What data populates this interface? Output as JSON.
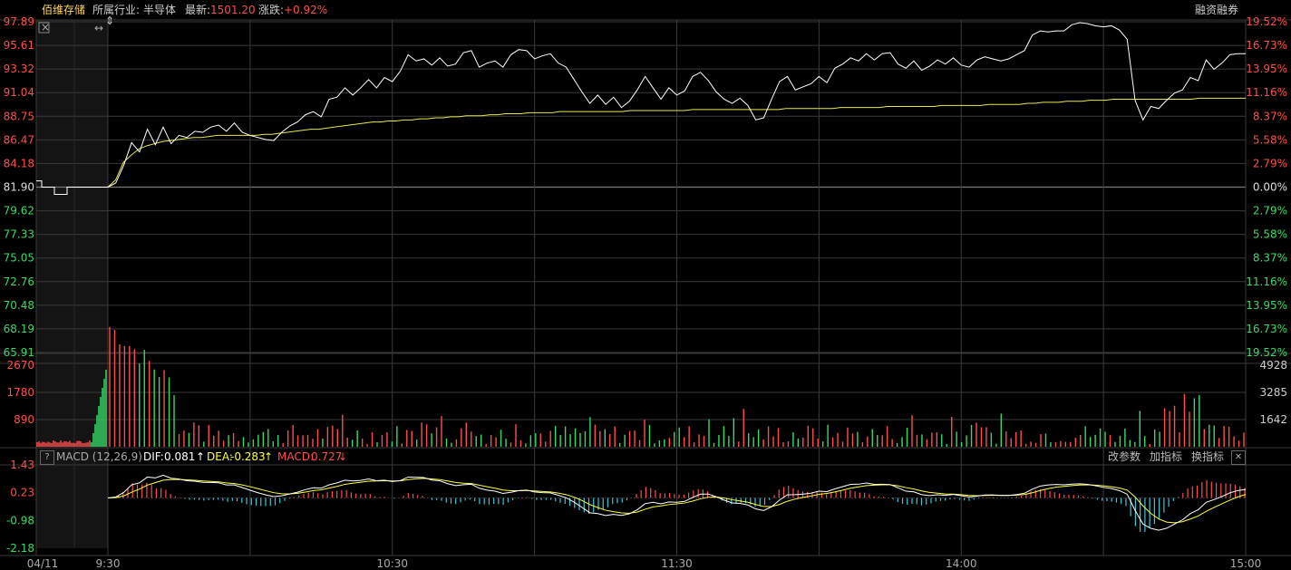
{
  "header": {
    "stock_name": "佰维存储",
    "industry_label": "所属行业:",
    "industry_value": "半导体",
    "last_label": "最新:",
    "last_value": "1501.20",
    "change_label": "涨跌:",
    "change_value": "+0.92%",
    "margin_label": "融资融券"
  },
  "colors": {
    "up": "#ff4d4d",
    "down": "#38d96a",
    "price": "#ffffff",
    "avg": "#e8e84a",
    "grid": "#3a3a3a",
    "dif": "#ffffff",
    "dea": "#ffff3c",
    "macd_neg": "#3cc8d8"
  },
  "chart_data": [
    {
      "type": "line",
      "name": "price",
      "y_ticks_left": [
        "97.89",
        "95.61",
        "93.32",
        "91.04",
        "88.75",
        "86.47",
        "84.18",
        "81.90",
        "79.62",
        "77.33",
        "75.05",
        "72.76",
        "70.48",
        "68.19",
        "65.91"
      ],
      "y_ticks_right": [
        "19.52%",
        "16.73%",
        "13.95%",
        "11.16%",
        "8.37%",
        "5.58%",
        "2.79%",
        "0.00%",
        "2.79%",
        "5.58%",
        "8.37%",
        "11.16%",
        "13.95%",
        "16.73%",
        "19.52%"
      ],
      "ylim": [
        65.91,
        97.89
      ],
      "prev_close": 81.9,
      "x_ticks": [
        "04/11",
        "9:30",
        "10:30",
        "11:30",
        "14:00",
        "15:00"
      ],
      "series": [
        {
          "values": [
            81.9,
            82.3,
            84.0,
            86.2,
            85.3,
            87.5,
            86.0,
            87.7,
            86.1,
            86.9,
            86.7,
            87.3,
            87.2,
            87.7,
            87.9,
            87.3,
            88.1,
            87.2,
            86.9,
            86.7,
            86.5,
            86.4,
            87.2,
            87.8,
            88.2,
            88.9,
            89.2,
            88.7,
            90.4,
            90.6,
            91.5,
            90.8,
            91.5,
            92.3,
            91.5,
            92.5,
            92.1,
            93.1,
            94.7,
            94.1,
            94.3,
            93.7,
            94.4,
            93.6,
            93.8,
            94.9,
            95.1,
            93.5,
            93.9,
            94.1,
            93.5,
            94.7,
            95.2,
            95.1,
            94.3,
            94.6,
            94.8,
            93.9,
            93.5,
            92.3,
            91.1,
            90.0,
            90.8,
            89.9,
            90.6,
            89.6,
            90.2,
            91.3,
            92.6,
            91.5,
            90.4,
            91.5,
            90.8,
            91.2,
            92.6,
            93.0,
            92.2,
            91.1,
            90.4,
            90.0,
            90.5,
            89.8,
            88.4,
            88.6,
            90.4,
            92.1,
            92.6,
            91.3,
            91.6,
            91.9,
            92.6,
            92.0,
            93.4,
            93.8,
            94.4,
            94.1,
            94.8,
            94.2,
            94.8,
            94.9,
            93.8,
            93.4,
            94.1,
            93.2,
            93.6,
            94.2,
            93.8,
            94.4,
            93.7,
            93.5,
            94.2,
            94.5,
            94.3,
            94.1,
            94.3,
            94.7,
            95.1,
            96.6,
            97.0,
            96.9,
            97.0,
            97.0,
            97.6,
            97.8,
            97.7,
            97.5,
            97.4,
            97.5,
            97.1,
            96.2,
            90.3,
            88.4,
            89.7,
            89.5,
            90.3,
            91.0,
            91.3,
            92.5,
            92.2,
            94.2,
            93.3,
            93.9,
            94.7,
            94.8,
            94.8
          ]
        },
        {
          "values": [
            81.9,
            82.6,
            84.3,
            85.0,
            85.6,
            85.9,
            86.1,
            86.3,
            86.4,
            86.5,
            86.6,
            86.7,
            86.7,
            86.8,
            86.9,
            86.9,
            86.9,
            86.9,
            86.9,
            86.9,
            87.0,
            87.0,
            87.1,
            87.2,
            87.3,
            87.4,
            87.5,
            87.5,
            87.6,
            87.7,
            87.8,
            87.9,
            88.0,
            88.1,
            88.2,
            88.2,
            88.3,
            88.3,
            88.4,
            88.4,
            88.5,
            88.5,
            88.6,
            88.6,
            88.7,
            88.7,
            88.8,
            88.8,
            88.8,
            88.9,
            88.9,
            89.0,
            89.0,
            89.0,
            89.1,
            89.1,
            89.1,
            89.1,
            89.2,
            89.2,
            89.2,
            89.2,
            89.2,
            89.2,
            89.2,
            89.2,
            89.2,
            89.3,
            89.3,
            89.3,
            89.3,
            89.3,
            89.3,
            89.3,
            89.3,
            89.4,
            89.4,
            89.4,
            89.4,
            89.4,
            89.4,
            89.4,
            89.4,
            89.4,
            89.4,
            89.4,
            89.4,
            89.5,
            89.5,
            89.5,
            89.5,
            89.5,
            89.5,
            89.5,
            89.6,
            89.6,
            89.6,
            89.6,
            89.6,
            89.6,
            89.7,
            89.7,
            89.7,
            89.7,
            89.7,
            89.7,
            89.7,
            89.8,
            89.8,
            89.8,
            89.8,
            89.8,
            89.8,
            89.9,
            89.9,
            89.9,
            89.9,
            89.9,
            90.0,
            90.0,
            90.1,
            90.1,
            90.1,
            90.2,
            90.2,
            90.2,
            90.3,
            90.3,
            90.3,
            90.4,
            90.4,
            90.4,
            90.4,
            90.4,
            90.4,
            90.4,
            90.4,
            90.4,
            90.4,
            90.4,
            90.5,
            90.5,
            90.5,
            90.5,
            90.5,
            90.5,
            90.5
          ]
        }
      ]
    },
    {
      "type": "bar",
      "name": "volume",
      "y_ticks_left": [
        "2670",
        "1780",
        "890"
      ],
      "y_ticks_right": [
        "4928",
        "3285",
        "1642"
      ],
      "ylim": [
        0,
        2670
      ]
    },
    {
      "type": "line",
      "name": "macd",
      "title": "MACD (12,26,9)",
      "dif_label": "DIF:",
      "dif_value": "0.081",
      "dea_label": "DEA:",
      "dea_value": "-0.283",
      "macd_label": "MACD:",
      "macd_value": "0.727",
      "y_ticks": [
        "1.43",
        "0.23",
        "-0.98",
        "-2.18"
      ],
      "ylim": [
        -2.18,
        1.43
      ]
    }
  ],
  "macd_toolbar": {
    "help": "?",
    "params_btn": "改参数",
    "add_btn": "加指标",
    "switch_btn": "换指标",
    "close": "✕"
  },
  "arrows": {
    "up": "↑",
    "down": "↓"
  }
}
